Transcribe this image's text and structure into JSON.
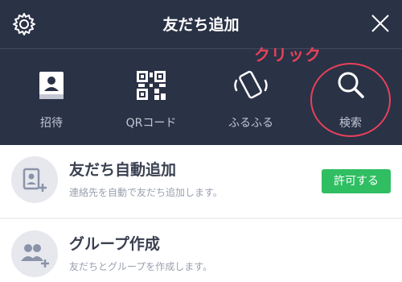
{
  "header": {
    "title": "友だち追加",
    "left_icon": "gear-icon",
    "right_icon": "close-icon",
    "annotation": "クリック"
  },
  "tools": [
    {
      "label": "招待",
      "icon": "contact-book-icon"
    },
    {
      "label": "QRコード",
      "icon": "qr-code-icon"
    },
    {
      "label": "ふるふる",
      "icon": "shake-phone-icon"
    },
    {
      "label": "検索",
      "icon": "search-icon"
    }
  ],
  "rows": [
    {
      "title": "友だち自動追加",
      "subtitle": "連絡先を自動で友だち追加します。",
      "icon": "add-friend-icon",
      "button_label": "許可する"
    },
    {
      "title": "グループ作成",
      "subtitle": "友だちとグループを作成します。",
      "icon": "group-add-icon"
    }
  ],
  "colors": {
    "header_bg": "#2a3246",
    "highlight": "#e8415a",
    "accent_green": "#2fbe62"
  }
}
